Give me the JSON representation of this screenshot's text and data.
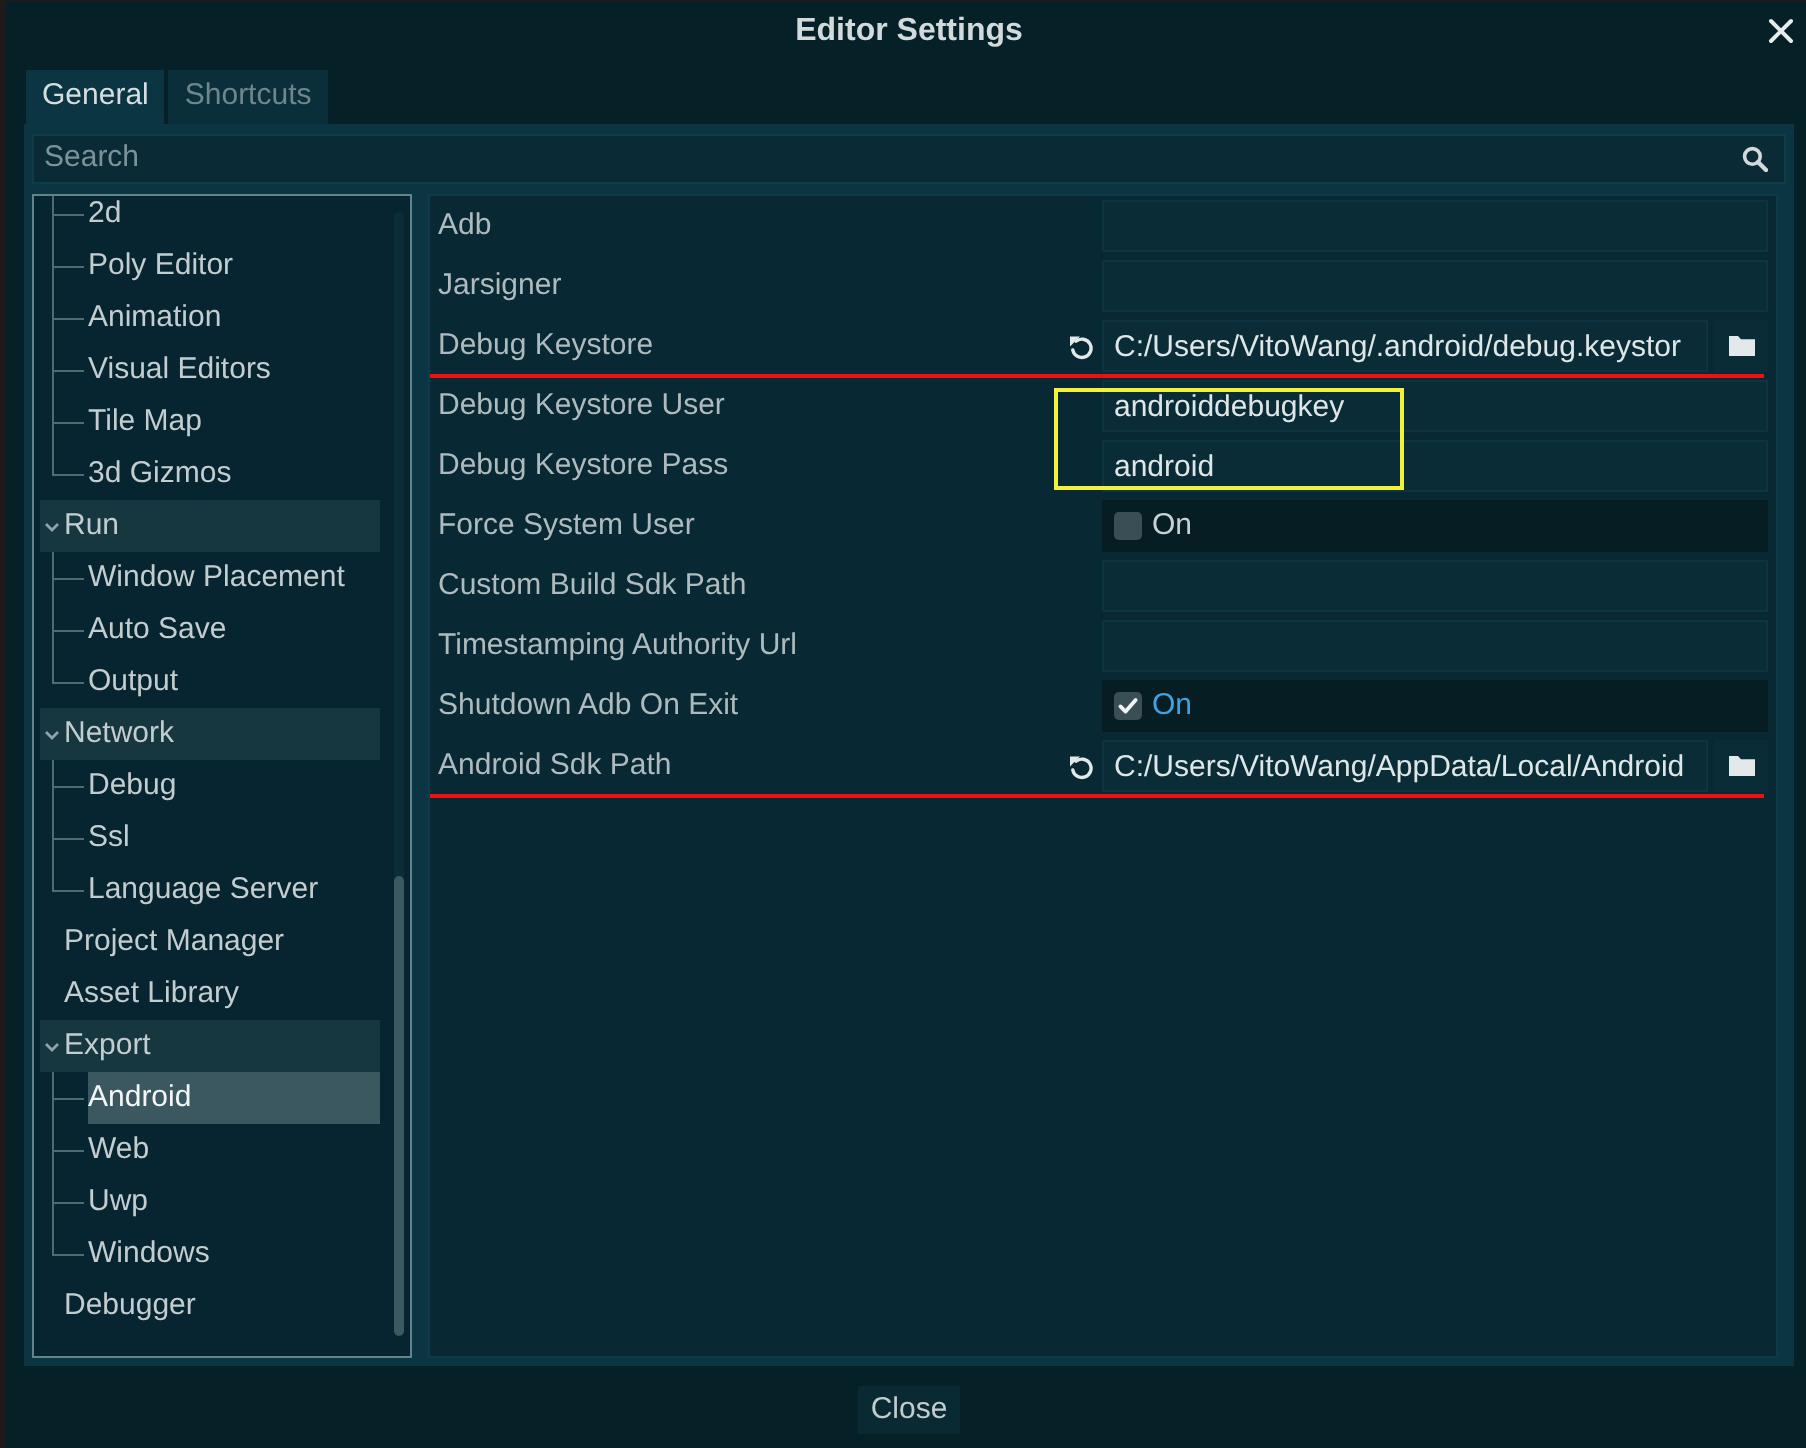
{
  "window": {
    "title": "Editor Settings"
  },
  "tabs": [
    {
      "label": "General",
      "selected": true
    },
    {
      "label": "Shortcuts",
      "selected": false
    }
  ],
  "search": {
    "placeholder": "Search"
  },
  "tree": [
    {
      "children": [
        {
          "label": "2d",
          "selected": false
        },
        {
          "label": "Poly Editor",
          "selected": false
        },
        {
          "label": "Animation",
          "selected": false
        },
        {
          "label": "Visual Editors",
          "selected": false
        },
        {
          "label": "Tile Map",
          "selected": false
        },
        {
          "label": "3d Gizmos",
          "selected": false
        }
      ]
    },
    {
      "label": "Run",
      "selected": false,
      "expanded": true,
      "children": [
        {
          "label": "Window Placement",
          "selected": false
        },
        {
          "label": "Auto Save",
          "selected": false
        },
        {
          "label": "Output",
          "selected": false
        }
      ]
    },
    {
      "label": "Network",
      "selected": false,
      "expanded": true,
      "children": [
        {
          "label": "Debug",
          "selected": false
        },
        {
          "label": "Ssl",
          "selected": false
        },
        {
          "label": "Language Server",
          "selected": false
        }
      ]
    },
    {
      "label": "Project Manager",
      "selected": false
    },
    {
      "label": "Asset Library",
      "selected": false
    },
    {
      "label": "Export",
      "selected": false,
      "expanded": true,
      "children": [
        {
          "label": "Android",
          "selected": true
        },
        {
          "label": "Web",
          "selected": false
        },
        {
          "label": "Uwp",
          "selected": false
        },
        {
          "label": "Windows",
          "selected": false
        }
      ]
    },
    {
      "label": "Debugger",
      "selected": false
    }
  ],
  "properties": [
    {
      "label": "Adb",
      "kind": "text",
      "revertable": false,
      "underlined": false,
      "framed": false
    },
    {
      "label": "Jarsigner",
      "kind": "text",
      "revertable": false,
      "underlined": false,
      "framed": false
    },
    {
      "label": "Debug Keystore",
      "kind": "file",
      "revertable": true,
      "value": "C:/Users/VitoWang/.android/debug.keystor",
      "underlined": true,
      "framed": false
    },
    {
      "label": "Debug Keystore User",
      "kind": "text",
      "revertable": false,
      "value": "androiddebugkey",
      "underlined": false,
      "framed": true
    },
    {
      "label": "Debug Keystore Pass",
      "kind": "text",
      "revertable": false,
      "value": "android",
      "underlined": false,
      "framed": true
    },
    {
      "label": "Force System User",
      "kind": "check",
      "revertable": false,
      "checked": false,
      "caption": "On",
      "underlined": false,
      "framed": false
    },
    {
      "label": "Custom Build Sdk Path",
      "kind": "text",
      "revertable": false,
      "underlined": false,
      "framed": false
    },
    {
      "label": "Timestamping Authority Url",
      "kind": "text",
      "revertable": false,
      "underlined": false,
      "framed": false
    },
    {
      "label": "Shutdown Adb On Exit",
      "kind": "check",
      "revertable": false,
      "checked": true,
      "caption": "On",
      "underlined": false,
      "framed": false
    },
    {
      "label": "Android Sdk Path",
      "kind": "file",
      "revertable": true,
      "value": "C:/Users/VitoWang/AppData/Local/Android",
      "underlined": true,
      "framed": false
    }
  ],
  "buttons": [
    {
      "label": "Close"
    }
  ]
}
